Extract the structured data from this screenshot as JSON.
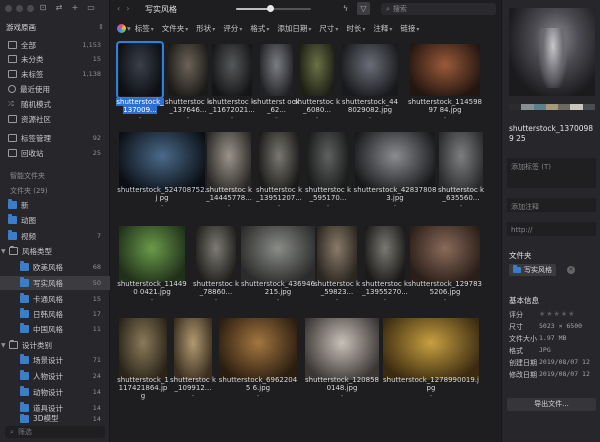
{
  "sidebar": {
    "library_name": "游戏原画",
    "items": [
      {
        "label": "全部",
        "count": "1,153"
      },
      {
        "label": "未分类",
        "count": "15"
      },
      {
        "label": "未标签",
        "count": "1,138"
      },
      {
        "label": "最近使用",
        "count": ""
      },
      {
        "label": "随机模式",
        "count": ""
      },
      {
        "label": "资源社区",
        "count": ""
      },
      {
        "label": "标签管理",
        "count": "92"
      },
      {
        "label": "回收站",
        "count": "25"
      }
    ],
    "smart_folders_label": "智能文件夹",
    "folders_label": "文件夹 (29)",
    "folders": [
      {
        "label": "新",
        "count": ""
      },
      {
        "label": "动图",
        "count": ""
      },
      {
        "label": "视频",
        "count": "7"
      },
      {
        "label": "风格类型",
        "count": ""
      },
      {
        "label": "欧美风格",
        "count": "68"
      },
      {
        "label": "写实风格",
        "count": "50"
      },
      {
        "label": "卡通风格",
        "count": "15"
      },
      {
        "label": "日韩风格",
        "count": "17"
      },
      {
        "label": "中国风格",
        "count": "11"
      },
      {
        "label": "设计类别",
        "count": ""
      },
      {
        "label": "场景设计",
        "count": "71"
      },
      {
        "label": "人物设计",
        "count": "24"
      },
      {
        "label": "动物设计",
        "count": "14"
      },
      {
        "label": "道具设计",
        "count": "14"
      },
      {
        "label": "3D模型",
        "count": "14"
      }
    ],
    "search_placeholder": "筛选"
  },
  "toolbar": {
    "folder_title": "写实风格",
    "zoom_percent": 45,
    "search_placeholder": "搜索"
  },
  "filters": [
    "标签",
    "文件夹",
    "形状",
    "评分",
    "格式",
    "添加日期",
    "尺寸",
    "时长",
    "注释",
    "链接"
  ],
  "grid": {
    "items": [
      {
        "name_pre": "",
        "name_hl": "shutterstock_137009",
        "name_post": "...",
        "dash": "-"
      },
      {
        "name_pre": "shutterstoc k_137646...",
        "name_hl": "",
        "name_post": "",
        "dash": "-"
      },
      {
        "name_pre": "shutterstoc k_11672021...",
        "name_hl": "",
        "name_post": "",
        "dash": "-"
      },
      {
        "name_pre": "shutterst ock_62...",
        "name_hl": "",
        "name_post": "",
        "dash": "-"
      },
      {
        "name_pre": "shutterstoc k_6080...",
        "name_hl": "",
        "name_post": "",
        "dash": "-"
      },
      {
        "name_pre": "shutterstock_44 8029082.jpg",
        "name_hl": "",
        "name_post": "",
        "dash": "-"
      },
      {
        "name_pre": "shutterstock_11459897 84.jpg",
        "name_hl": "",
        "name_post": "",
        "dash": "-"
      },
      {
        "name_pre": "shutterstock_524708752.j pg",
        "name_hl": "",
        "name_post": "",
        "dash": "-"
      },
      {
        "name_pre": "shutterstoc k_14445778...",
        "name_hl": "",
        "name_post": "",
        "dash": "-"
      },
      {
        "name_pre": "shutterstoc k_13951207...",
        "name_hl": "",
        "name_post": "",
        "dash": "-"
      },
      {
        "name_pre": "shutterstoc k_595170...",
        "name_hl": "",
        "name_post": "",
        "dash": "-"
      },
      {
        "name_pre": "shutterstock_42837808 3.jpg",
        "name_hl": "",
        "name_post": "",
        "dash": "-"
      },
      {
        "name_pre": "shutterstoc k_635560...",
        "name_hl": "",
        "name_post": "",
        "dash": "-"
      },
      {
        "name_pre": "shutterstock_114490 0421.jpg",
        "name_hl": "",
        "name_post": "",
        "dash": "-"
      },
      {
        "name_pre": "shutterstoc k_78860...",
        "name_hl": "",
        "name_post": "",
        "dash": "-"
      },
      {
        "name_pre": "shutterstock_436946 215.jpg",
        "name_hl": "",
        "name_post": "",
        "dash": "-"
      },
      {
        "name_pre": "shutterstoc k_59823...",
        "name_hl": "",
        "name_post": "",
        "dash": "-"
      },
      {
        "name_pre": "shutterstoc k_13955270...",
        "name_hl": "",
        "name_post": "",
        "dash": "-"
      },
      {
        "name_pre": "shutterstock_129783 5206.jpg",
        "name_hl": "",
        "name_post": "",
        "dash": "-"
      },
      {
        "name_pre": "shutterstock_1 117421864.jpg",
        "name_hl": "",
        "name_post": "",
        "dash": "-"
      },
      {
        "name_pre": "shutterstoc k_109912...",
        "name_hl": "",
        "name_post": "",
        "dash": "-"
      },
      {
        "name_pre": "shutterstock_69622045 6.jpg",
        "name_hl": "",
        "name_post": "",
        "dash": "-"
      },
      {
        "name_pre": "shutterstock_120858 0148.jpg",
        "name_hl": "",
        "name_post": "",
        "dash": "-"
      },
      {
        "name_pre": "shutterstock_1278990019.jpg",
        "name_hl": "",
        "name_post": "",
        "dash": "-"
      }
    ]
  },
  "inspector": {
    "palette": [
      "#2b2b2e",
      "#8a8f93",
      "#5e7f8c",
      "#a6987a",
      "#6d6a60",
      "#c8c6bd",
      "#4a4d52"
    ],
    "file_name": "shutterstock_13700989 25",
    "tag_placeholder": "添加标签 (T)",
    "note_placeholder": "添加注释",
    "url_placeholder": "http://",
    "folder_section": "文件夹",
    "folder_tag": "写实风格",
    "basic_info": "基本信息",
    "info": [
      {
        "label": "评分",
        "value": ""
      },
      {
        "label": "尺寸",
        "value": "5023 × 6500"
      },
      {
        "label": "文件大小",
        "value": "1.97 MB"
      },
      {
        "label": "格式",
        "value": "JPG"
      },
      {
        "label": "创建日期",
        "value": "2019/08/07 12"
      },
      {
        "label": "修改日期",
        "value": "2019/08/07 12"
      }
    ],
    "export_label": "导出文件..."
  }
}
